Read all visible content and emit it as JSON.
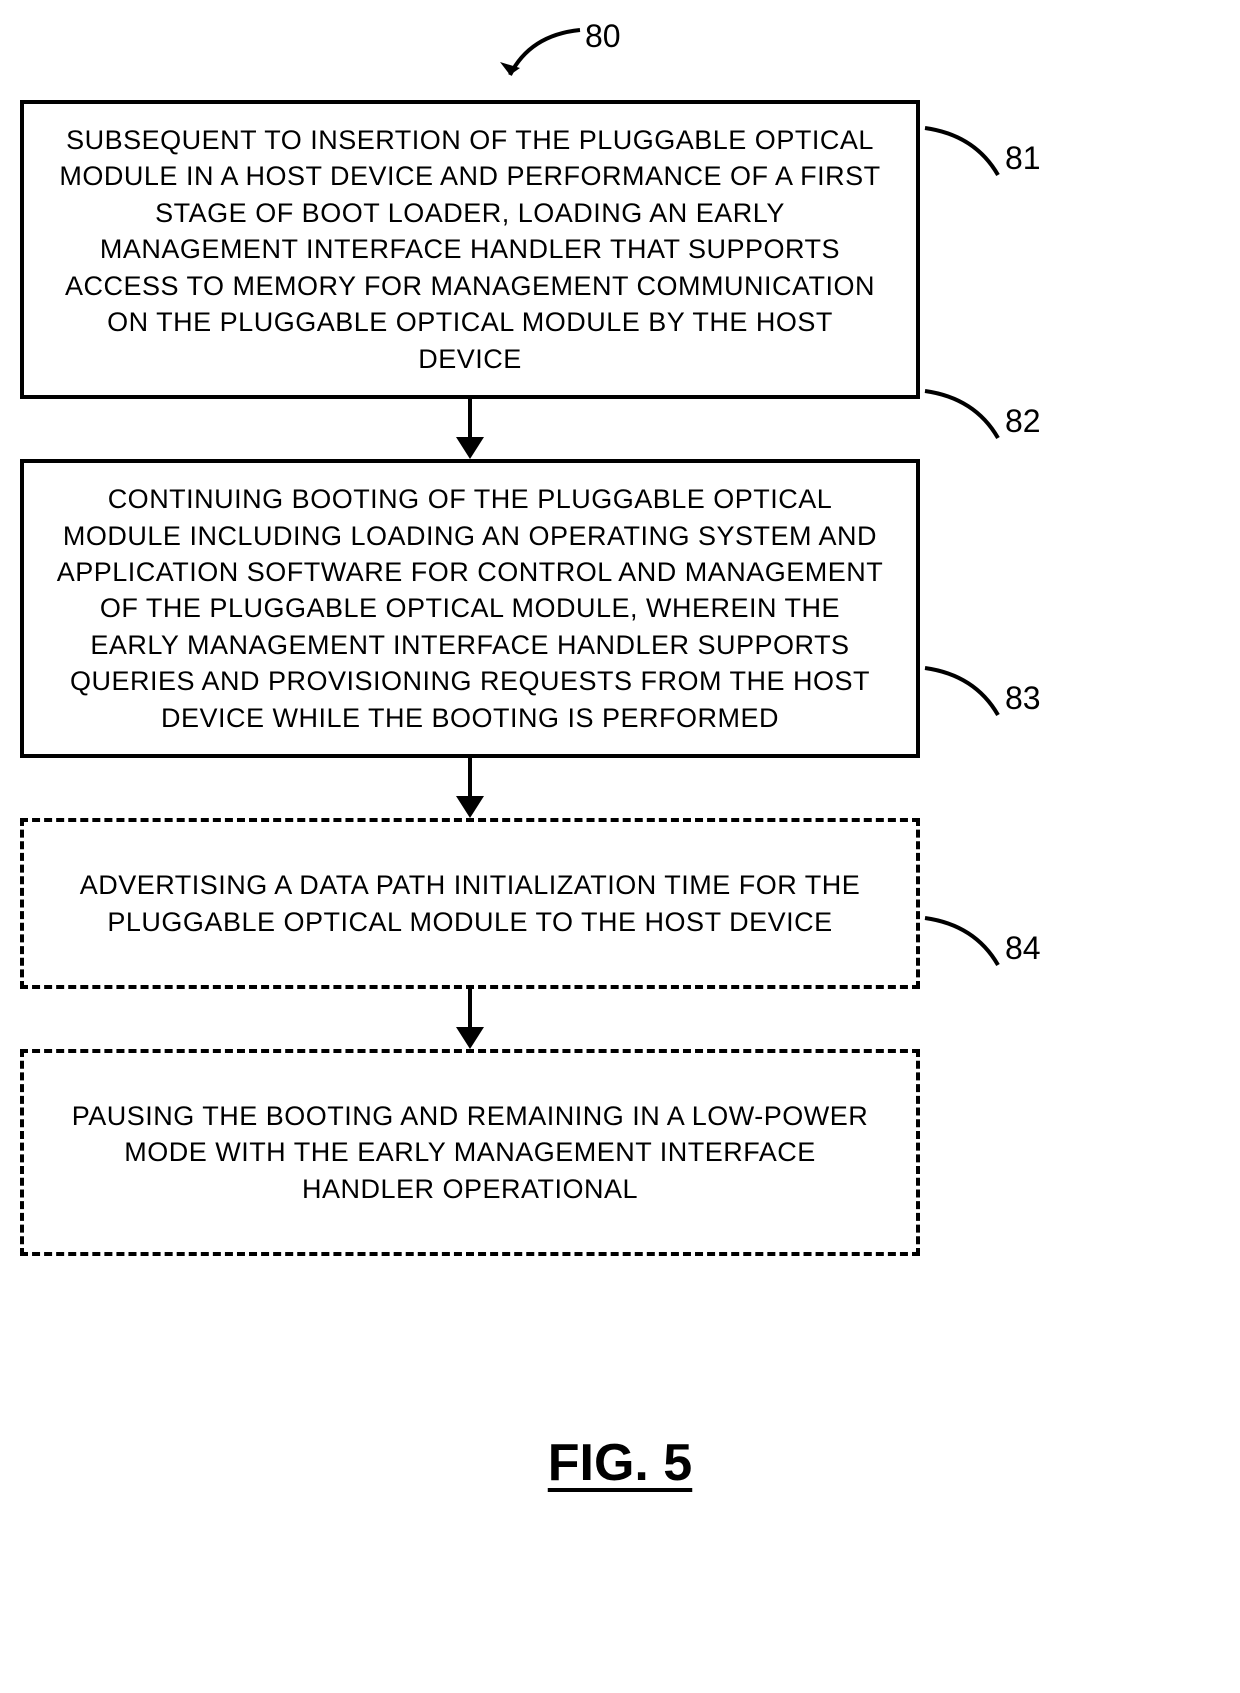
{
  "chart_data": {
    "type": "flowchart",
    "title": "FIG. 5",
    "main_reference": "80",
    "steps": [
      {
        "id": "81",
        "style": "solid",
        "text": "SUBSEQUENT TO INSERTION OF THE PLUGGABLE OPTICAL MODULE IN A HOST DEVICE AND PERFORMANCE OF A FIRST STAGE OF BOOT LOADER, LOADING AN EARLY MANAGEMENT INTERFACE HANDLER THAT SUPPORTS ACCESS TO MEMORY FOR MANAGEMENT COMMUNICATION ON THE PLUGGABLE OPTICAL MODULE BY THE HOST DEVICE"
      },
      {
        "id": "82",
        "style": "solid",
        "text": "CONTINUING BOOTING OF THE PLUGGABLE OPTICAL MODULE INCLUDING LOADING AN OPERATING SYSTEM AND APPLICATION SOFTWARE FOR CONTROL AND MANAGEMENT OF THE PLUGGABLE OPTICAL MODULE, WHEREIN THE EARLY MANAGEMENT INTERFACE HANDLER SUPPORTS QUERIES AND PROVISIONING REQUESTS FROM THE HOST DEVICE WHILE THE BOOTING IS PERFORMED"
      },
      {
        "id": "83",
        "style": "dashed",
        "text": "ADVERTISING A DATA PATH INITIALIZATION TIME FOR THE PLUGGABLE OPTICAL MODULE TO THE HOST DEVICE"
      },
      {
        "id": "84",
        "style": "dashed",
        "text": "PAUSING THE BOOTING AND REMAINING IN A LOW-POWER MODE WITH THE EARLY MANAGEMENT INTERFACE HANDLER OPERATIONAL"
      }
    ]
  }
}
